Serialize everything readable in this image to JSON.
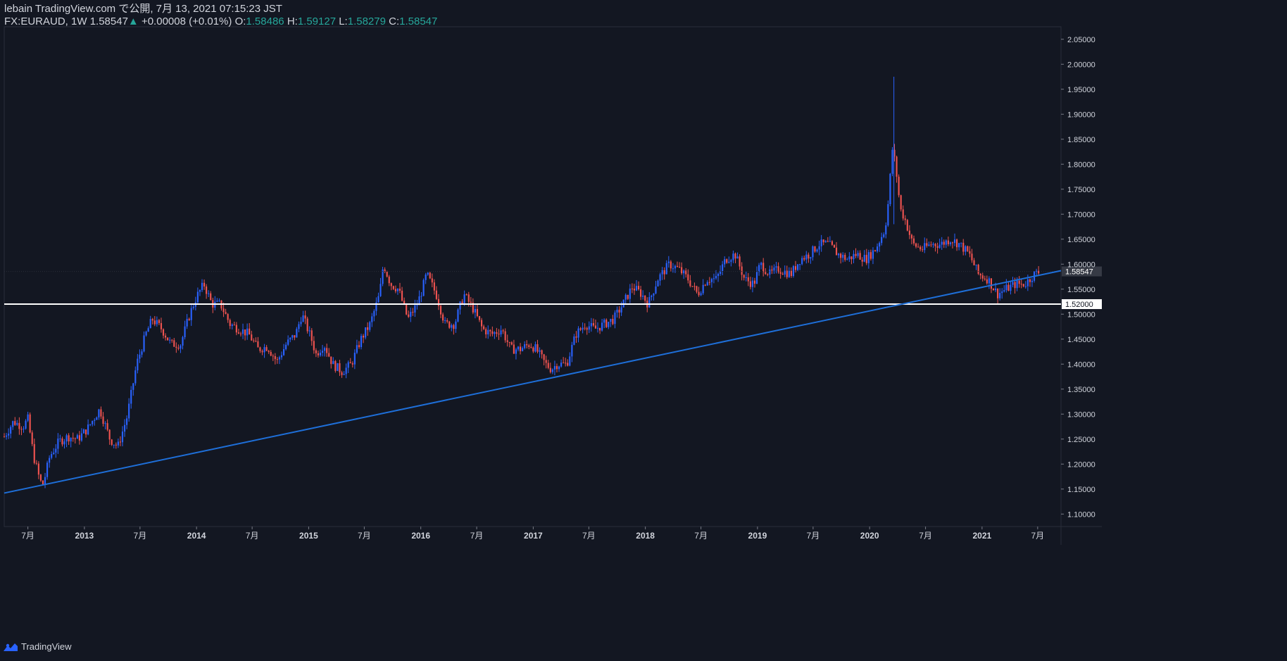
{
  "header": {
    "line1": "lebain TradingView.com で公開, 7月 13, 2021 07:15:23 JST",
    "symbol": "FX:EURAUD, 1W",
    "last": "1.58547",
    "change_arrow": "▲",
    "change": "+0.00008 (+0.01%)",
    "o_label": "O:",
    "o_val": "1.58486",
    "h_label": "H:",
    "h_val": "1.59127",
    "l_label": "L:",
    "l_val": "1.58279",
    "c_label": "C:",
    "c_val": "1.58547"
  },
  "footer": {
    "brand": "TradingView",
    "logo_icon": "tradingview-logo-icon"
  },
  "colors": {
    "background": "#131722",
    "up": "#2962ff",
    "down": "#ef5350",
    "trendline": "#1e6fd9",
    "hline": "#ffffff",
    "text": "#d1d4dc",
    "axis": "#787b86"
  },
  "chart_data": {
    "type": "candlestick",
    "ylim": [
      1.075,
      2.075
    ],
    "y_ticks": [
      "2.05000",
      "2.00000",
      "1.95000",
      "1.90000",
      "1.85000",
      "1.80000",
      "1.75000",
      "1.70000",
      "1.65000",
      "1.60000",
      "1.55000",
      "1.50000",
      "1.45000",
      "1.40000",
      "1.35000",
      "1.30000",
      "1.25000",
      "1.20000",
      "1.15000",
      "1.10000"
    ],
    "x_ticks": [
      {
        "date": "2012-07-01",
        "label": "7月"
      },
      {
        "date": "2013-01-01",
        "label": "2013"
      },
      {
        "date": "2013-07-01",
        "label": "7月"
      },
      {
        "date": "2014-01-01",
        "label": "2014"
      },
      {
        "date": "2014-07-01",
        "label": "7月"
      },
      {
        "date": "2015-01-01",
        "label": "2015"
      },
      {
        "date": "2015-07-01",
        "label": "7月"
      },
      {
        "date": "2016-01-01",
        "label": "2016"
      },
      {
        "date": "2016-07-01",
        "label": "7月"
      },
      {
        "date": "2017-01-01",
        "label": "2017"
      },
      {
        "date": "2017-07-01",
        "label": "7月"
      },
      {
        "date": "2018-01-01",
        "label": "2018"
      },
      {
        "date": "2018-07-01",
        "label": "7月"
      },
      {
        "date": "2019-01-01",
        "label": "2019"
      },
      {
        "date": "2019-07-01",
        "label": "7月"
      },
      {
        "date": "2020-01-01",
        "label": "2020"
      },
      {
        "date": "2020-07-01",
        "label": "7月"
      },
      {
        "date": "2021-01-01",
        "label": "2021"
      },
      {
        "date": "2021-07-01",
        "label": "7月"
      }
    ],
    "price_path": [
      [
        "2012-04-15",
        1.255
      ],
      [
        "2012-05-15",
        1.285
      ],
      [
        "2012-06-15",
        1.275
      ],
      [
        "2012-07-01",
        1.29
      ],
      [
        "2012-07-20",
        1.215
      ],
      [
        "2012-08-10",
        1.165
      ],
      [
        "2012-08-20",
        1.16
      ],
      [
        "2012-09-10",
        1.215
      ],
      [
        "2012-10-10",
        1.245
      ],
      [
        "2012-11-10",
        1.255
      ],
      [
        "2012-12-10",
        1.25
      ],
      [
        "2013-01-10",
        1.27
      ],
      [
        "2013-02-20",
        1.31
      ],
      [
        "2013-03-25",
        1.25
      ],
      [
        "2013-04-20",
        1.235
      ],
      [
        "2013-05-20",
        1.295
      ],
      [
        "2013-06-20",
        1.4
      ],
      [
        "2013-07-20",
        1.46
      ],
      [
        "2013-08-10",
        1.49
      ],
      [
        "2013-09-10",
        1.47
      ],
      [
        "2013-10-10",
        1.44
      ],
      [
        "2013-11-10",
        1.44
      ],
      [
        "2013-12-10",
        1.5
      ],
      [
        "2014-01-01",
        1.535
      ],
      [
        "2014-01-25",
        1.56
      ],
      [
        "2014-02-20",
        1.52
      ],
      [
        "2014-03-20",
        1.52
      ],
      [
        "2014-04-20",
        1.48
      ],
      [
        "2014-05-20",
        1.47
      ],
      [
        "2014-06-20",
        1.46
      ],
      [
        "2014-07-20",
        1.43
      ],
      [
        "2014-08-20",
        1.435
      ],
      [
        "2014-09-20",
        1.405
      ],
      [
        "2014-10-20",
        1.44
      ],
      [
        "2014-11-20",
        1.46
      ],
      [
        "2014-12-10",
        1.5
      ],
      [
        "2015-01-10",
        1.45
      ],
      [
        "2015-01-25",
        1.42
      ],
      [
        "2015-02-20",
        1.44
      ],
      [
        "2015-03-20",
        1.4
      ],
      [
        "2015-04-20",
        1.385
      ],
      [
        "2015-05-20",
        1.4
      ],
      [
        "2015-06-20",
        1.45
      ],
      [
        "2015-07-20",
        1.48
      ],
      [
        "2015-08-20",
        1.54
      ],
      [
        "2015-09-01",
        1.6
      ],
      [
        "2015-09-25",
        1.56
      ],
      [
        "2015-10-20",
        1.55
      ],
      [
        "2015-11-20",
        1.49
      ],
      [
        "2015-12-20",
        1.52
      ],
      [
        "2016-01-01",
        1.54
      ],
      [
        "2016-01-20",
        1.58
      ],
      [
        "2016-02-20",
        1.54
      ],
      [
        "2016-03-20",
        1.48
      ],
      [
        "2016-04-20",
        1.48
      ],
      [
        "2016-05-20",
        1.54
      ],
      [
        "2016-06-20",
        1.51
      ],
      [
        "2016-07-20",
        1.47
      ],
      [
        "2016-08-20",
        1.46
      ],
      [
        "2016-09-20",
        1.47
      ],
      [
        "2016-10-20",
        1.43
      ],
      [
        "2016-11-20",
        1.43
      ],
      [
        "2016-12-20",
        1.44
      ],
      [
        "2017-01-10",
        1.43
      ],
      [
        "2017-02-10",
        1.4
      ],
      [
        "2017-03-01",
        1.39
      ],
      [
        "2017-03-20",
        1.4
      ],
      [
        "2017-04-20",
        1.4
      ],
      [
        "2017-05-20",
        1.46
      ],
      [
        "2017-06-20",
        1.48
      ],
      [
        "2017-07-20",
        1.47
      ],
      [
        "2017-08-20",
        1.48
      ],
      [
        "2017-09-20",
        1.49
      ],
      [
        "2017-10-20",
        1.52
      ],
      [
        "2017-11-20",
        1.555
      ],
      [
        "2017-12-20",
        1.54
      ],
      [
        "2018-01-10",
        1.52
      ],
      [
        "2018-02-10",
        1.57
      ],
      [
        "2018-03-20",
        1.6
      ],
      [
        "2018-04-20",
        1.59
      ],
      [
        "2018-05-20",
        1.57
      ],
      [
        "2018-06-20",
        1.54
      ],
      [
        "2018-07-20",
        1.57
      ],
      [
        "2018-08-20",
        1.57
      ],
      [
        "2018-09-20",
        1.61
      ],
      [
        "2018-10-20",
        1.62
      ],
      [
        "2018-11-20",
        1.57
      ],
      [
        "2018-12-20",
        1.56
      ],
      [
        "2019-01-10",
        1.6
      ],
      [
        "2019-02-10",
        1.58
      ],
      [
        "2019-03-10",
        1.59
      ],
      [
        "2019-04-20",
        1.58
      ],
      [
        "2019-05-20",
        1.61
      ],
      [
        "2019-06-20",
        1.62
      ],
      [
        "2019-07-20",
        1.64
      ],
      [
        "2019-08-20",
        1.64
      ],
      [
        "2019-09-20",
        1.62
      ],
      [
        "2019-10-20",
        1.61
      ],
      [
        "2019-11-20",
        1.62
      ],
      [
        "2019-12-20",
        1.61
      ],
      [
        "2020-01-20",
        1.63
      ],
      [
        "2020-02-20",
        1.67
      ],
      [
        "2020-03-01",
        1.72
      ],
      [
        "2020-03-15",
        1.83
      ],
      [
        "2020-03-25",
        1.8
      ],
      [
        "2020-04-10",
        1.71
      ],
      [
        "2020-04-25",
        1.69
      ],
      [
        "2020-05-20",
        1.64
      ],
      [
        "2020-06-20",
        1.63
      ],
      [
        "2020-07-20",
        1.64
      ],
      [
        "2020-08-20",
        1.64
      ],
      [
        "2020-09-20",
        1.65
      ],
      [
        "2020-10-20",
        1.64
      ],
      [
        "2020-11-20",
        1.62
      ],
      [
        "2020-12-20",
        1.58
      ],
      [
        "2021-01-20",
        1.57
      ],
      [
        "2021-02-20",
        1.54
      ],
      [
        "2021-03-20",
        1.55
      ],
      [
        "2021-04-20",
        1.56
      ],
      [
        "2021-05-20",
        1.56
      ],
      [
        "2021-06-20",
        1.58
      ],
      [
        "2021-07-10",
        1.585
      ]
    ],
    "spike": {
      "date": "2020-03-20",
      "high": 1.975,
      "low": 1.68
    },
    "horizontal_line": {
      "value": 1.52,
      "label": "1.52000"
    },
    "last_price": {
      "value": 1.58547,
      "label": "1.58547"
    },
    "trendline": {
      "x1": "2012-04-15",
      "y1": 1.142,
      "x2": "2021-09-15",
      "y2": 1.587
    }
  }
}
